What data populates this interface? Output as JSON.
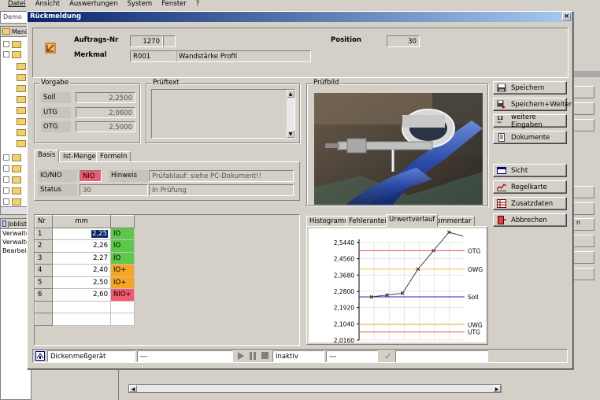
{
  "app": {
    "menu": [
      "Datei",
      "Ansicht",
      "Auswertungen",
      "System",
      "Fenster",
      "?"
    ],
    "title_tab_left": "Demo",
    "tree_header": "Menü",
    "jobs_header": "Jobliste",
    "jobs_rows": [
      "Verwalte",
      "Verwalte",
      "Bearbeit"
    ],
    "bg_button_partial": "n"
  },
  "dialog": {
    "title": "Rückmeldung",
    "close_glyph": "×",
    "header": {
      "auftrag_label": "Auftrags-Nr",
      "auftrag_value": "1270",
      "auftrag_suffix": "",
      "merkmal_label": "Merkmal",
      "merkmal_code": "R001",
      "merkmal_name": "Wandstärke Profil",
      "position_label": "Position",
      "position_value": "30"
    },
    "vorgabe": {
      "title": "Vorgabe",
      "rows": [
        {
          "label": "Soll",
          "value": "2,2500"
        },
        {
          "label": "UTG",
          "value": "2,0600"
        },
        {
          "label": "OTG",
          "value": "2,5000"
        }
      ]
    },
    "prueftext": {
      "title": "Prüftext",
      "value": ""
    },
    "pruefbild": {
      "title": "Prüfbild"
    },
    "basis_tabs": [
      "Basis",
      "Ist-Menge",
      "Formeln"
    ],
    "basis": {
      "ionio_label": "IO/NIO",
      "ionio_value": "NIO",
      "hinweis_label": "Hinweis",
      "hinweis_value": "Prüfablauf: siehe PC-Dokument!!",
      "status_label": "Status",
      "status_code": "30",
      "status_text": "In Prüfung"
    },
    "measurements": {
      "headers": [
        "Nr",
        "mm",
        ""
      ],
      "rows": [
        {
          "nr": "1",
          "mm": "2,25",
          "status": "IO",
          "color": "#5cc94a"
        },
        {
          "nr": "2",
          "mm": "2,26",
          "status": "IO",
          "color": "#5cc94a"
        },
        {
          "nr": "3",
          "mm": "2,27",
          "status": "IO",
          "color": "#5cc94a"
        },
        {
          "nr": "4",
          "mm": "2,40",
          "status": "IO+",
          "color": "#f5a623"
        },
        {
          "nr": "5",
          "mm": "2,50",
          "status": "IO+",
          "color": "#f5a623"
        },
        {
          "nr": "6",
          "mm": "2,60",
          "status": "NIO+",
          "color": "#f25a6e"
        }
      ]
    },
    "buttons": {
      "speichern": "Speichern",
      "speichern_weiter": "Speichern+Weiter",
      "weitere": "weitere Eingaben",
      "dokumente": "Dokumente",
      "sicht": "Sicht",
      "regelkarte": "Regelkarte",
      "zusatzdaten": "Zusatzdaten",
      "abbrechen": "Abbrechen"
    },
    "chart_tabs": [
      "Histogramm",
      "Fehleranteil",
      "Urwertverlauf",
      "Kommentar"
    ],
    "status_bar": {
      "device": "Dickenmeßgerät",
      "field1": "---",
      "state": "Inaktiv",
      "field2": "---"
    }
  },
  "chart_data": {
    "type": "line",
    "title": "",
    "x": [
      1,
      2,
      3,
      4,
      5,
      6
    ],
    "series": [
      {
        "values": [
          2.25,
          2.26,
          2.27,
          2.4,
          2.5,
          2.6
        ]
      }
    ],
    "yticks": [
      "2,5440",
      "2,4560",
      "2,3680",
      "2,2800",
      "2,1920",
      "2,1040",
      "2,0160"
    ],
    "ylim": [
      2.016,
      2.544
    ],
    "reference_lines": [
      {
        "name": "OTG",
        "value": 2.5,
        "color": "#e05050"
      },
      {
        "name": "OWG",
        "value": 2.4,
        "color": "#e8c040"
      },
      {
        "name": "Soll",
        "value": 2.25,
        "color": "#2020c0"
      },
      {
        "name": "UWG",
        "value": 2.1,
        "color": "#e8c040"
      },
      {
        "name": "UTG",
        "value": 2.06,
        "color": "#e05050"
      }
    ],
    "grid": true,
    "xlim": [
      0.2,
      7.0
    ]
  }
}
